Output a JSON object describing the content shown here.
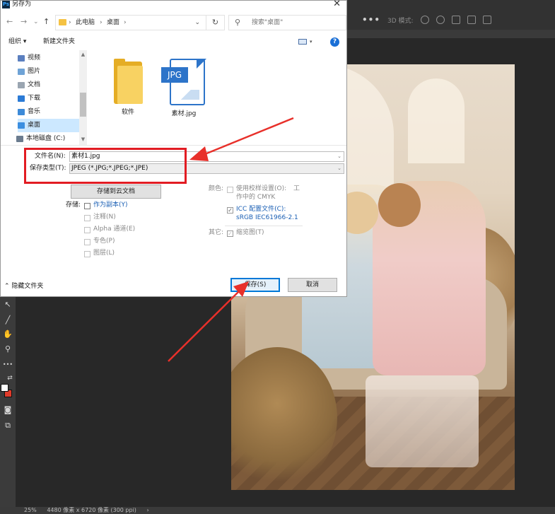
{
  "dialog": {
    "title": "另存为",
    "app_icon_label": "Ps",
    "close_glyph": "✕",
    "nav": {
      "back_glyph": "←",
      "forward_glyph": "→",
      "history_glyph": "⌄",
      "up_glyph": "↑",
      "breadcrumb": [
        "此电脑",
        "桌面"
      ],
      "separator": "›",
      "dropdown_glyph": "⌄",
      "refresh_glyph": "↻",
      "search_placeholder": "搜索\"桌面\"",
      "search_icon": "search-icon"
    },
    "command_bar": {
      "organize_label": "组织 ▾",
      "new_folder_label": "新建文件夹",
      "view_dropdown_glyph": "▾",
      "help_label": "?"
    },
    "nav_pane": {
      "items": [
        {
          "label": "视频",
          "icon": "video-folder-icon",
          "color": "#5b7fbf"
        },
        {
          "label": "图片",
          "icon": "pictures-folder-icon",
          "color": "#6fa3d6"
        },
        {
          "label": "文档",
          "icon": "documents-folder-icon",
          "color": "#9aa5b1"
        },
        {
          "label": "下载",
          "icon": "downloads-folder-icon",
          "color": "#2b7bd6"
        },
        {
          "label": "音乐",
          "icon": "music-folder-icon",
          "color": "#3d8ad8"
        },
        {
          "label": "桌面",
          "icon": "desktop-folder-icon",
          "color": "#3c8fe0",
          "selected": true
        },
        {
          "label": "本地磁盘 (C:)",
          "icon": "local-disk-icon",
          "color": "#6b7c8f"
        }
      ],
      "scroll_up_glyph": "▲",
      "scroll_down_glyph": "▼"
    },
    "files": [
      {
        "name": "软件",
        "type": "folder",
        "icon": "folder-icon"
      },
      {
        "name": "素材.jpg",
        "type": "jpg",
        "icon": "jpg-file-icon",
        "badge": "JPG"
      }
    ],
    "filename_label": "文件名(N):",
    "filename_value": "素材1.jpg",
    "filetype_label": "保存类型(T):",
    "filetype_value": "JPEG (*.JPG;*.JPEG;*.JPE)",
    "field_dropdown_glyph": "⌄",
    "cloud_button": "存储到云文档",
    "save_section_label": "存储:",
    "save_options": [
      {
        "label": "作为副本(Y)",
        "enabled": true,
        "checked": false
      },
      {
        "label": "注释(N)",
        "enabled": false,
        "checked": false
      },
      {
        "label": "Alpha 通道(E)",
        "enabled": false,
        "checked": false
      },
      {
        "label": "专色(P)",
        "enabled": false,
        "checked": false
      },
      {
        "label": "图层(L)",
        "enabled": false,
        "checked": false
      }
    ],
    "color_section_label": "颜色:",
    "proof_setup_line1": "使用校样设置(O):",
    "proof_setup_suffix": "工",
    "proof_setup_line2": "作中的 CMYK",
    "icc_line1": "ICC 配置文件(C):",
    "icc_line2": "sRGB IEC61966-2.1",
    "icc_checked": true,
    "other_section_label": "其它:",
    "thumbnail_label": "缩览图(T)",
    "thumbnail_checked": true,
    "check_glyph": "✓",
    "hide_folders_label": "隐藏文件夹",
    "hide_folders_glyph": "⌃",
    "save_button": "保存(S)",
    "cancel_button": "取消"
  },
  "photoshop": {
    "more_glyph": "•••",
    "three_d_mode_label": "3D 模式:",
    "tools": [
      {
        "glyph": "↖",
        "name": "direct-select-tool-icon"
      },
      {
        "glyph": "╱",
        "name": "line-tool-icon"
      },
      {
        "glyph": "✋",
        "name": "hand-tool-icon"
      },
      {
        "glyph": "⚲",
        "name": "zoom-tool-icon"
      },
      {
        "glyph": "•••",
        "name": "more-tools-icon"
      },
      {
        "glyph": "⇄",
        "name": "swap-colors-icon"
      },
      {
        "glyph": "◙",
        "name": "quick-mask-icon"
      },
      {
        "glyph": "⧉",
        "name": "screen-mode-icon"
      }
    ],
    "status_zoom": "25%",
    "status_info": "4480 像素 x 6720 像素 (300 ppi)",
    "status_arrow": "›"
  },
  "annotations": {
    "highlight_color": "#e21c23",
    "arrow_color": "#e8302a"
  }
}
